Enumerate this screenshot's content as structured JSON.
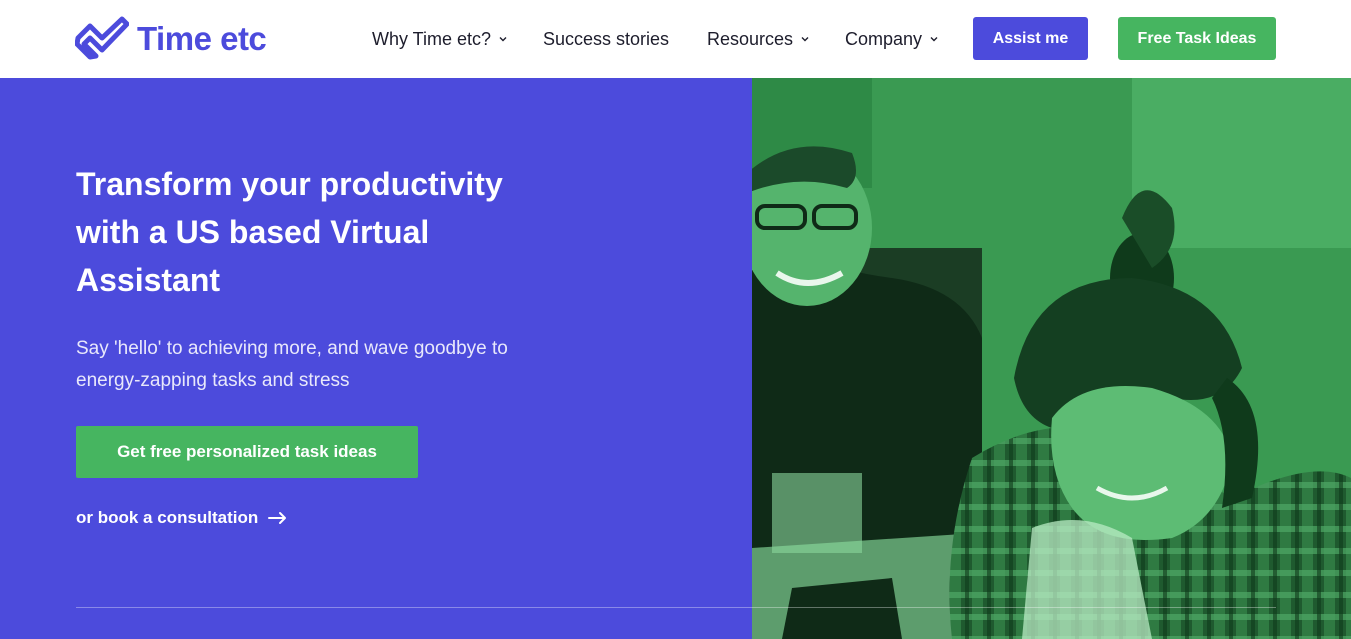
{
  "brand": {
    "name": "Time etc",
    "primary_color": "#4c4bdc",
    "accent_color": "#46b560",
    "logo_icon": "check-heart-logo-icon"
  },
  "nav": {
    "items": [
      {
        "label": "Why Time etc?",
        "has_dropdown": true
      },
      {
        "label": "Success stories",
        "has_dropdown": false
      },
      {
        "label": "Resources",
        "has_dropdown": true
      },
      {
        "label": "Company",
        "has_dropdown": true
      }
    ],
    "assist_label": "Assist me",
    "free_tasks_label": "Free Task Ideas"
  },
  "hero": {
    "title": "Transform your productivity with a US based Virtual Assistant",
    "subtitle": "Say 'hello' to achieving more, and wave goodbye to energy-zapping tasks and stress",
    "cta_label": "Get free personalized task ideas",
    "secondary_link": "or book a consultation",
    "secondary_icon": "arrow-right-icon",
    "image_icon": "hero-photo"
  }
}
